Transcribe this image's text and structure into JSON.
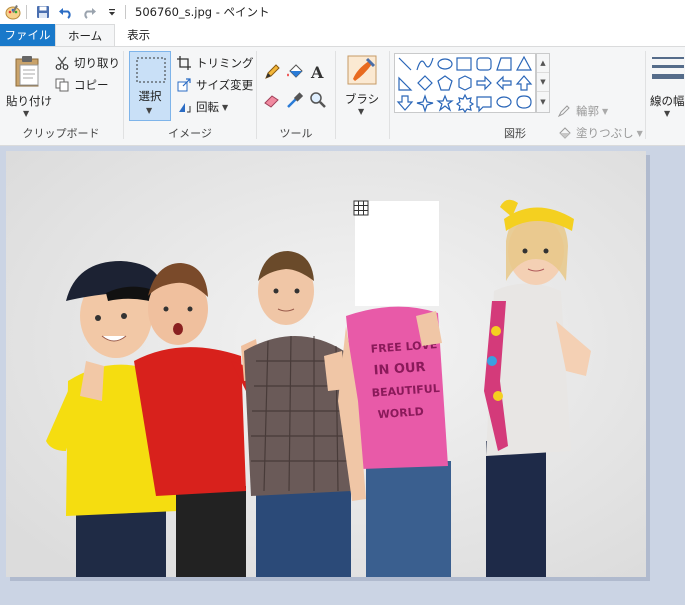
{
  "titlebar": {
    "title": "506760_s.jpg - ペイント",
    "qa_menu_icon": "paint-app-icon",
    "qa_save_icon": "save-icon",
    "qa_undo_icon": "undo-icon",
    "qa_redo_icon": "redo-icon",
    "qa_customize_icon": "customize-quick-access-icon"
  },
  "tabs": {
    "file": "ファイル",
    "home": "ホーム",
    "view": "表示"
  },
  "ribbon": {
    "clipboard": {
      "label": "クリップボード",
      "paste": "貼り付け",
      "cut": "切り取り",
      "copy": "コピー"
    },
    "image": {
      "label": "イメージ",
      "select": "選択",
      "crop": "トリミング",
      "resize": "サイズ変更",
      "rotate": "回転"
    },
    "tools": {
      "label": "ツール"
    },
    "brushes": {
      "label": "ブラシ"
    },
    "shapes": {
      "label": "図形",
      "outline": "輪郭",
      "fill": "塗りつぶし"
    },
    "size": {
      "label": "線の幅"
    }
  },
  "colors": {
    "file_tab": "#1979ca",
    "ribbon_bg": "#f5f6f7",
    "workspace_bg": "#cbd4e4",
    "select_highlight": "#c9e0f7"
  }
}
